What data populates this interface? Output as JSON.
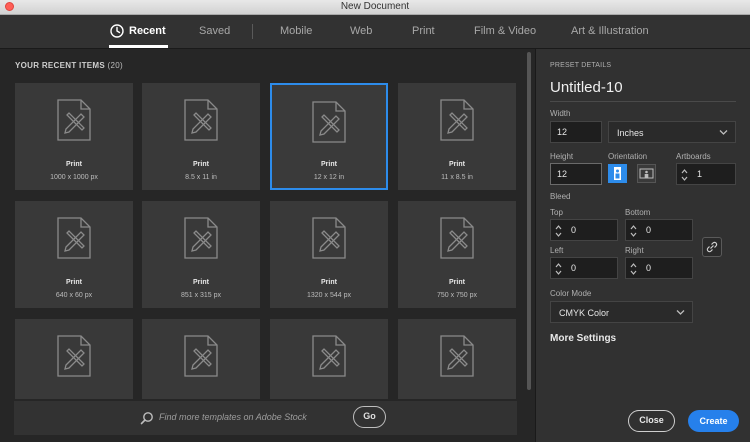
{
  "window": {
    "title": "New Document"
  },
  "nav": {
    "tabs": [
      {
        "label": "Recent",
        "active": true,
        "icon": "clock-icon"
      },
      {
        "label": "Saved"
      },
      {
        "label": "Mobile"
      },
      {
        "label": "Web"
      },
      {
        "label": "Print"
      },
      {
        "label": "Film & Video"
      },
      {
        "label": "Art & Illustration"
      }
    ]
  },
  "recent": {
    "heading": "YOUR RECENT ITEMS",
    "count": "(20)",
    "items": [
      {
        "type": "Print",
        "size": "1000 x 1000 px"
      },
      {
        "type": "Print",
        "size": "8.5 x 11 in"
      },
      {
        "type": "Print",
        "size": "12 x 12 in",
        "selected": true
      },
      {
        "type": "Print",
        "size": "11 x 8.5 in"
      },
      {
        "type": "Print",
        "size": "640 x 60 px"
      },
      {
        "type": "Print",
        "size": "851 x 315 px"
      },
      {
        "type": "Print",
        "size": "1320 x 544 px"
      },
      {
        "type": "Print",
        "size": "750 x 750 px"
      },
      {
        "type": "",
        "size": ""
      },
      {
        "type": "",
        "size": ""
      },
      {
        "type": "",
        "size": ""
      },
      {
        "type": "",
        "size": ""
      }
    ]
  },
  "stock": {
    "placeholder": "Find more templates on Adobe Stock",
    "go_label": "Go"
  },
  "preset": {
    "heading": "PRESET DETAILS",
    "name": "Untitled-10",
    "width_label": "Width",
    "width_value": "12",
    "units": "Inches",
    "height_label": "Height",
    "height_value": "12",
    "orientation_label": "Orientation",
    "orientation": "portrait",
    "artboards_label": "Artboards",
    "artboards_value": "1",
    "bleed_label": "Bleed",
    "top_label": "Top",
    "top_value": "0",
    "bottom_label": "Bottom",
    "bottom_value": "0",
    "left_label": "Left",
    "left_value": "0",
    "right_label": "Right",
    "right_value": "0",
    "color_mode_label": "Color Mode",
    "color_mode": "CMYK Color",
    "more_settings": "More Settings"
  },
  "actions": {
    "close_label": "Close",
    "create_label": "Create"
  },
  "colors": {
    "accent": "#2680eb",
    "selection": "#2d8ceb",
    "panel": "#313131",
    "background": "#262626"
  }
}
